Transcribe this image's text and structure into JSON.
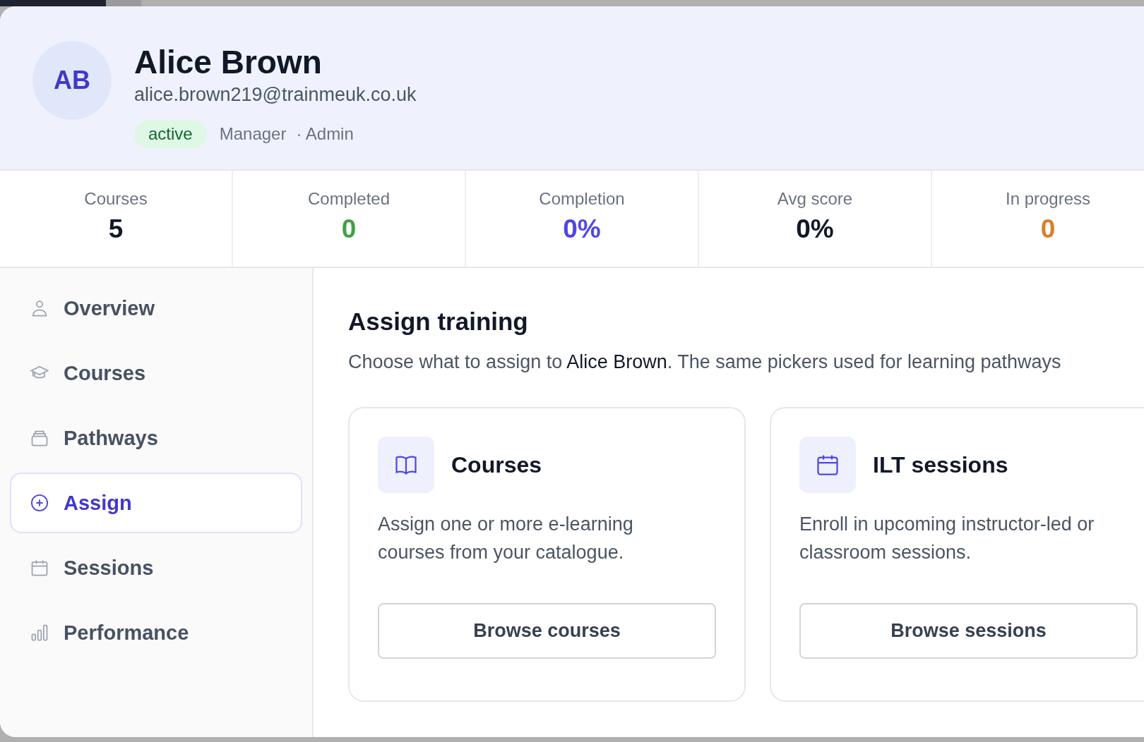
{
  "profile": {
    "initials": "AB",
    "name": "Alice Brown",
    "email": "alice.brown219@trainmeuk.co.uk",
    "status": "active",
    "roles": [
      "Manager",
      "· Admin"
    ]
  },
  "stats": [
    {
      "label": "Courses",
      "value": "5",
      "color": "#111827"
    },
    {
      "label": "Completed",
      "value": "0",
      "color": "#43a047"
    },
    {
      "label": "Completion",
      "value": "0%",
      "color": "#4f46e5"
    },
    {
      "label": "Avg score",
      "value": "0%",
      "color": "#111827"
    },
    {
      "label": "In progress",
      "value": "0",
      "color": "#d97f2a"
    }
  ],
  "sidebar": {
    "items": [
      {
        "label": "Overview",
        "selected": false
      },
      {
        "label": "Courses",
        "selected": false
      },
      {
        "label": "Pathways",
        "selected": false
      },
      {
        "label": "Assign",
        "selected": true
      },
      {
        "label": "Sessions",
        "selected": false
      },
      {
        "label": "Performance",
        "selected": false
      }
    ]
  },
  "main": {
    "title": "Assign training",
    "subtitle": "Choose what to assign to **Alice Brown**. The same pickers used for learning pathways",
    "cards": [
      {
        "title": "Courses",
        "description": "Assign one or more e-learning courses from your catalogue.",
        "button": "Browse courses"
      },
      {
        "title": "ILT sessions",
        "description": "Enroll in upcoming instructor-led or classroom sessions.",
        "button": "Browse sessions"
      }
    ]
  }
}
